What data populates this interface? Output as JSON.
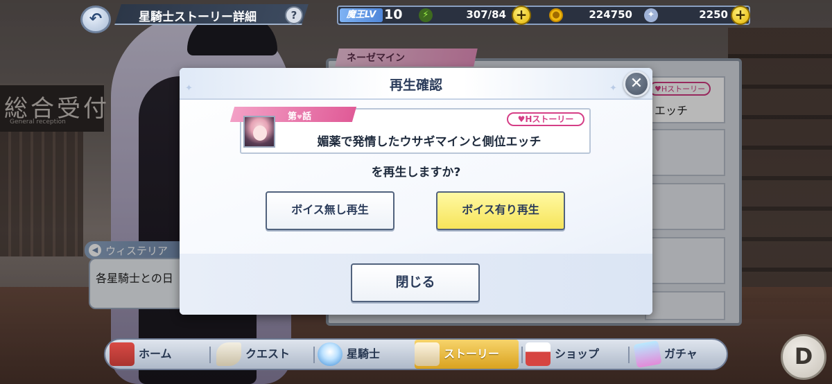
{
  "background": {
    "reception_sign": "総合受付",
    "reception_sub": "General reception",
    "behind_panel": {
      "character_tab": "ネーゼマイン",
      "item_htag": "♥Hストーリー",
      "item_title": "エッチ"
    },
    "dialogue": {
      "speaker": "ウィステリア",
      "text": "各星騎士との日"
    }
  },
  "header": {
    "back_icon": "↶",
    "title": "星騎士ストーリー詳細",
    "help_label": "?"
  },
  "stats": {
    "level_label": "魔王LV",
    "level_value": "10",
    "energy": "307/84",
    "coins": "224750",
    "gems": "2250",
    "plus_label": "+",
    "energy_icon": "⚡",
    "coin_icon": "●",
    "gem_icon": "✦"
  },
  "modal": {
    "title": "再生確認",
    "close_label": "✕",
    "episode_label_prefix": "第",
    "episode_label_heart": "♥",
    "episode_label_suffix": "話",
    "htag": "♥Hストーリー",
    "story_title": "媚薬で発情したウサギマインと側位エッチ",
    "question": "を再生しますか?",
    "button_no_voice": "ボイス無し再生",
    "button_voice": "ボイス有り再生",
    "button_close": "閉じる"
  },
  "nav": {
    "home": "ホーム",
    "quest": "クエスト",
    "knight": "星騎士",
    "story": "ストーリー",
    "shop": "ショップ",
    "gacha": "ガチャ"
  },
  "d_button": "D"
}
